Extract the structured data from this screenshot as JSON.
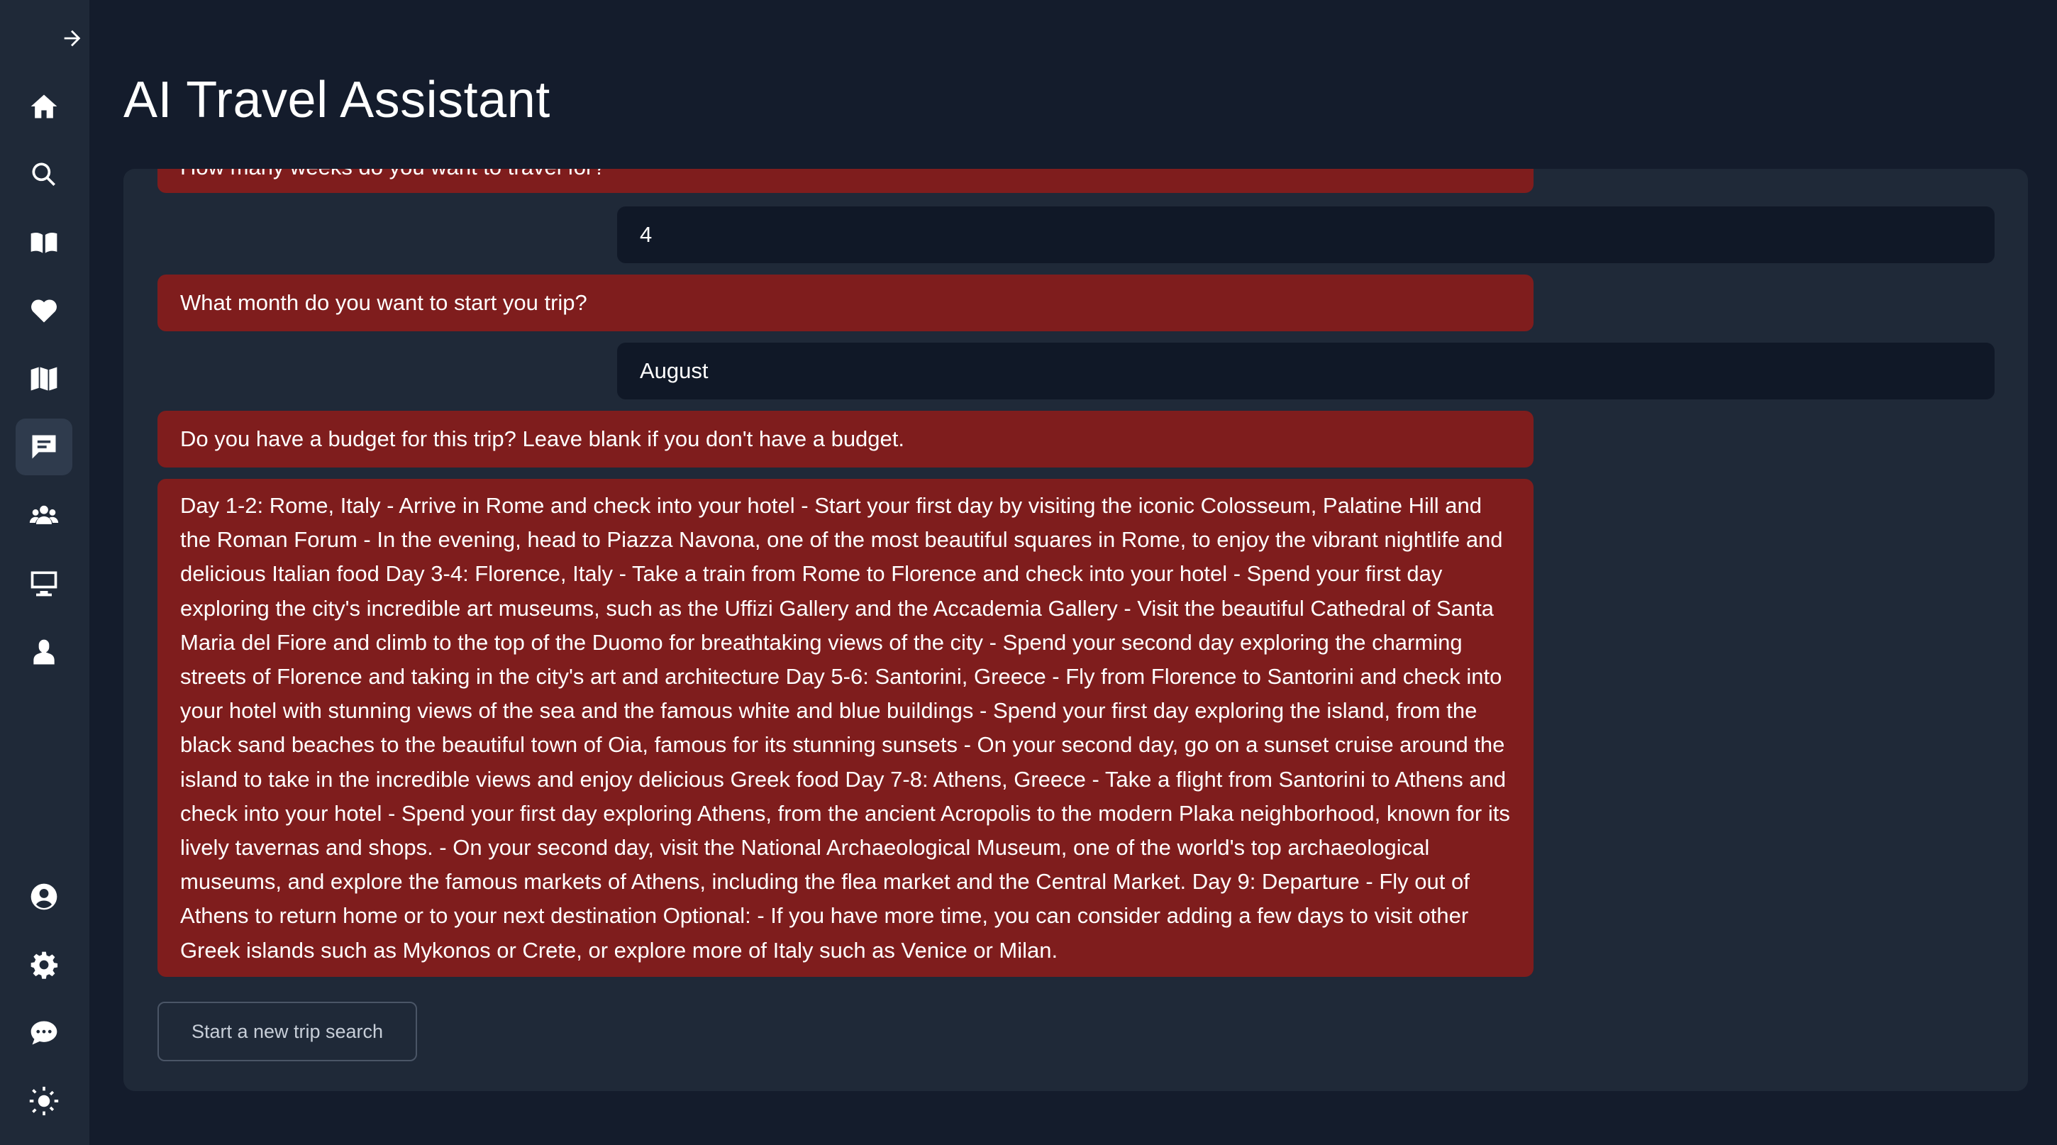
{
  "app": {
    "title": "AI Travel Assistant"
  },
  "sidebar": {
    "top_items": [
      {
        "name": "home-icon"
      },
      {
        "name": "search-icon"
      },
      {
        "name": "book-icon"
      },
      {
        "name": "heart-icon"
      },
      {
        "name": "map-icon"
      },
      {
        "name": "chat-icon",
        "active": true
      },
      {
        "name": "users-icon"
      },
      {
        "name": "monitor-icon"
      },
      {
        "name": "person-icon"
      }
    ],
    "bottom_items": [
      {
        "name": "account-icon"
      },
      {
        "name": "gear-icon"
      },
      {
        "name": "feedback-icon"
      },
      {
        "name": "theme-icon"
      }
    ],
    "expand_icon": "arrow-right-icon"
  },
  "chat": {
    "messages": [
      {
        "role": "assistant",
        "text": "How many weeks do you want to travel for?"
      },
      {
        "role": "user",
        "text": "4"
      },
      {
        "role": "assistant",
        "text": "What month do you want to start you trip?"
      },
      {
        "role": "user",
        "text": "August"
      },
      {
        "role": "assistant",
        "text": "Do you have a budget for this trip? Leave blank if you don't have a budget."
      },
      {
        "role": "assistant",
        "text": "Day 1-2: Rome, Italy - Arrive in Rome and check into your hotel - Start your first day by visiting the iconic Colosseum, Palatine Hill and the Roman Forum - In the evening, head to Piazza Navona, one of the most beautiful squares in Rome, to enjoy the vibrant nightlife and delicious Italian food Day 3-4: Florence, Italy - Take a train from Rome to Florence and check into your hotel - Spend your first day exploring the city's incredible art museums, such as the Uffizi Gallery and the Accademia Gallery - Visit the beautiful Cathedral of Santa Maria del Fiore and climb to the top of the Duomo for breathtaking views of the city - Spend your second day exploring the charming streets of Florence and taking in the city's art and architecture Day 5-6: Santorini, Greece - Fly from Florence to Santorini and check into your hotel with stunning views of the sea and the famous white and blue buildings - Spend your first day exploring the island, from the black sand beaches to the beautiful town of Oia, famous for its stunning sunsets - On your second day, go on a sunset cruise around the island to take in the incredible views and enjoy delicious Greek food Day 7-8: Athens, Greece - Take a flight from Santorini to Athens and check into your hotel - Spend your first day exploring Athens, from the ancient Acropolis to the modern Plaka neighborhood, known for its lively tavernas and shops. - On your second day, visit the National Archaeological Museum, one of the world's top archaeological museums, and explore the famous markets of Athens, including the flea market and the Central Market. Day 9: Departure - Fly out of Athens to return home or to your next destination Optional: - If you have more time, you can consider adding a few days to visit other Greek islands such as Mykonos or Crete, or explore more of Italy such as Venice or Milan."
      }
    ],
    "new_search_label": "Start a new trip search"
  },
  "colors": {
    "background": "#141c2c",
    "sidebar": "#1f2938",
    "panel": "#1f2938",
    "assistant_bubble": "#7f1d1d",
    "user_bubble": "#101827"
  }
}
